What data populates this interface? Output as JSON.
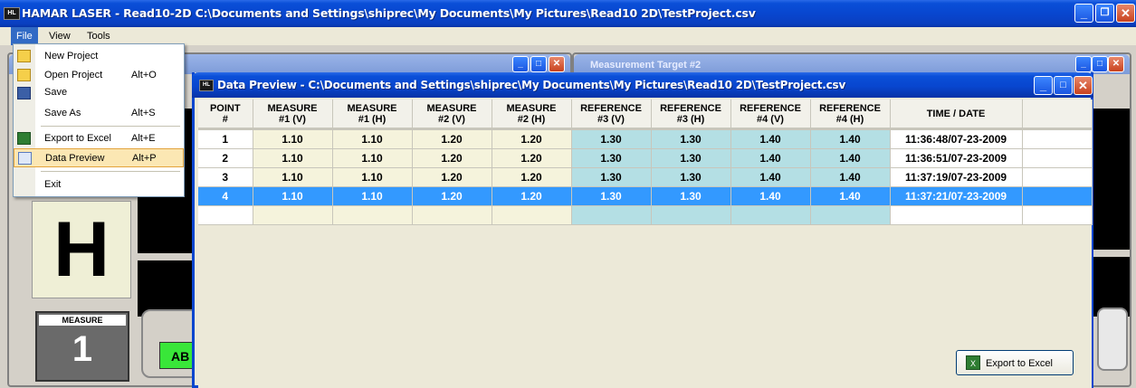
{
  "window": {
    "title": "HAMAR LASER - Read10-2D C:\\Documents and Settings\\shiprec\\My Documents\\My Pictures\\Read10 2D\\TestProject.csv",
    "icon_label": "HL"
  },
  "menubar": [
    "File",
    "View",
    "Tools"
  ],
  "file_menu": {
    "items": [
      {
        "label": "New Project",
        "shortcut": "",
        "icon": "folder-icon"
      },
      {
        "label": "Open Project",
        "shortcut": "Alt+O",
        "icon": "open-folder-icon"
      },
      {
        "label": "Save",
        "shortcut": "",
        "icon": "save-icon"
      },
      {
        "label": "Save As",
        "shortcut": "Alt+S",
        "icon": ""
      },
      {
        "label": "Export to Excel",
        "shortcut": "Alt+E",
        "icon": "excel-icon"
      },
      {
        "label": "Data Preview",
        "shortcut": "Alt+P",
        "icon": "table-icon"
      },
      {
        "label": "Exit",
        "shortcut": "",
        "icon": ""
      }
    ]
  },
  "background": {
    "mdi_title": "Measurement  Target #2",
    "h_letter": "H",
    "measure_label": "MEASURE",
    "measure_value": "1",
    "green_label": "AB"
  },
  "dialog": {
    "title": "Data Preview - C:\\Documents and Settings\\shiprec\\My Documents\\My Pictures\\Read10 2D\\TestProject.csv",
    "columns": [
      [
        "POINT",
        "#"
      ],
      [
        "MEASURE",
        "#1 (V)"
      ],
      [
        "MEASURE",
        "#1 (H)"
      ],
      [
        "MEASURE",
        "#2 (V)"
      ],
      [
        "MEASURE",
        "#2 (H)"
      ],
      [
        "REFERENCE",
        "#3 (V)"
      ],
      [
        "REFERENCE",
        "#3 (H)"
      ],
      [
        "REFERENCE",
        "#4 (V)"
      ],
      [
        "REFERENCE",
        "#4 (H)"
      ],
      [
        "TIME / DATE",
        ""
      ]
    ],
    "rows": [
      [
        "1",
        "1.10",
        "1.10",
        "1.20",
        "1.20",
        "1.30",
        "1.30",
        "1.40",
        "1.40",
        "11:36:48/07-23-2009"
      ],
      [
        "2",
        "1.10",
        "1.10",
        "1.20",
        "1.20",
        "1.30",
        "1.30",
        "1.40",
        "1.40",
        "11:36:51/07-23-2009"
      ],
      [
        "3",
        "1.10",
        "1.10",
        "1.20",
        "1.20",
        "1.30",
        "1.30",
        "1.40",
        "1.40",
        "11:37:19/07-23-2009"
      ],
      [
        "4",
        "1.10",
        "1.10",
        "1.20",
        "1.20",
        "1.30",
        "1.30",
        "1.40",
        "1.40",
        "11:37:21/07-23-2009"
      ]
    ],
    "selected_row": 3,
    "export_button": "Export to Excel"
  },
  "colors": {
    "title_blue": "#0846cf",
    "menu_highlight": "#fbe7b3",
    "selection": "#3399ff",
    "reference_cell": "#b4dfe4",
    "measure_cell": "#f5f3dc",
    "green_button": "#39e639"
  }
}
